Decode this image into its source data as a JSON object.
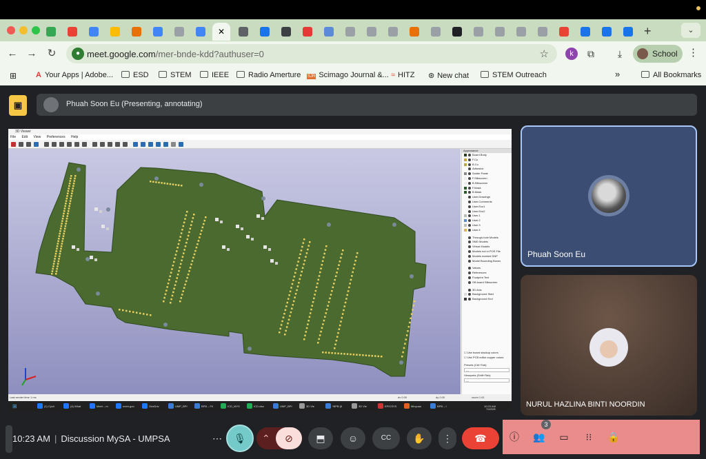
{
  "browser": {
    "tabs_count_visible": 28,
    "url_host": "meet.google.com",
    "url_path": "/mer-bnde-kdd?authuser=0",
    "profile_label": "School",
    "bookmarks": [
      {
        "label": "Your Apps | Adobe...",
        "icon": "adobe-icon"
      },
      {
        "label": "ESD",
        "icon": "folder-icon"
      },
      {
        "label": "STEM",
        "icon": "folder-icon"
      },
      {
        "label": "IEEE",
        "icon": "folder-icon"
      },
      {
        "label": "Radio Amerture",
        "icon": "folder-icon"
      },
      {
        "label": "Scimago Journal &...",
        "icon": "sjr-icon"
      },
      {
        "label": "HITZ",
        "icon": "hitz-icon"
      },
      {
        "label": "New chat",
        "icon": "chatgpt-icon"
      },
      {
        "label": "STEM Outreach",
        "icon": "folder-icon"
      }
    ],
    "all_bookmarks_label": "All Bookmarks"
  },
  "meet": {
    "presenter_banner": "Phuah Soon Eu (Presenting, annotating)",
    "participants": [
      {
        "name": "Phuah Soon Eu"
      },
      {
        "name": "NURUL HAZLINA BINTI NOORDIN"
      }
    ],
    "time": "10:23 AM",
    "meeting_title": "Discussion MySA - UMPSA",
    "people_count": "3",
    "colors": {
      "end_call": "#ea4335",
      "mic_active": "#74c9c9",
      "right_panel": "#ea8c8c",
      "present_icon": "#f6c744"
    }
  },
  "shared_screen": {
    "window_title": "3D Viewer",
    "menu": [
      "File",
      "Edit",
      "View",
      "Preferences",
      "Help"
    ],
    "appearance_header": "Appearance",
    "layers": [
      {
        "label": "Board Body",
        "color": "#2b3d22"
      },
      {
        "label": "F.Cu",
        "color": "#c8a838"
      },
      {
        "label": "B.Cu",
        "color": "#b8a840"
      },
      {
        "label": "Adhesive",
        "color": ""
      },
      {
        "label": "Solder Paste",
        "color": "#8a8a8a"
      },
      {
        "label": "F.Silkscreen",
        "color": "#eeeeee"
      },
      {
        "label": "B.Silkscreen",
        "color": "#eeeeee"
      },
      {
        "label": "F.Mask",
        "color": "#2a5a2a"
      },
      {
        "label": "B.Mask",
        "color": "#2a5a2a"
      },
      {
        "label": "User.Drawings",
        "color": ""
      },
      {
        "label": "User.Comments",
        "color": ""
      },
      {
        "label": "User.Eco1",
        "color": ""
      },
      {
        "label": "User.Eco2",
        "color": ""
      },
      {
        "label": "User.1",
        "color": "#bbbbbb"
      },
      {
        "label": "User.2",
        "color": "#5a8acc"
      },
      {
        "label": "User.3",
        "color": "#bbbbbb"
      },
      {
        "label": "User.4",
        "color": "#d8b850"
      }
    ],
    "models": [
      "Through-hole Models",
      "SMD Models",
      "Virtual Models",
      "Models not in POS File",
      "Models marked DNP",
      "Model Bounding Boxes"
    ],
    "extras": [
      "Values",
      "References",
      "Footprint Text",
      "Off-board Silkscreen"
    ],
    "axes": [
      "3D Axis",
      "Background Start",
      "Background End"
    ],
    "options": [
      "Use board stackup colors",
      "Use PCB editor copper colors"
    ],
    "presets_label": "Presets (Ctrl+Tab):",
    "viewports_label": "Viewports (Shift+Tab):",
    "status_left": "Last render time 1 ms",
    "status_dx": "dx 0.00",
    "status_dy": "dy 0.00",
    "status_zoom": "zoom 1.61",
    "taskbar_items": [
      "(1) Cycli",
      "(4) What",
      "Meet – m",
      "meet.goo",
      "OneDriv",
      "UMP_BPI",
      "BPB – Fil",
      "ICD_MYS",
      "ICD.xlsx",
      "UMP_BPI",
      "3D Vie",
      "*BPB (fi",
      "3D Vie",
      "EPICSYS",
      "Minyuan",
      "BPB – I"
    ],
    "taskbar_time": "10:23 AM",
    "taskbar_date": "7/4/2025"
  }
}
